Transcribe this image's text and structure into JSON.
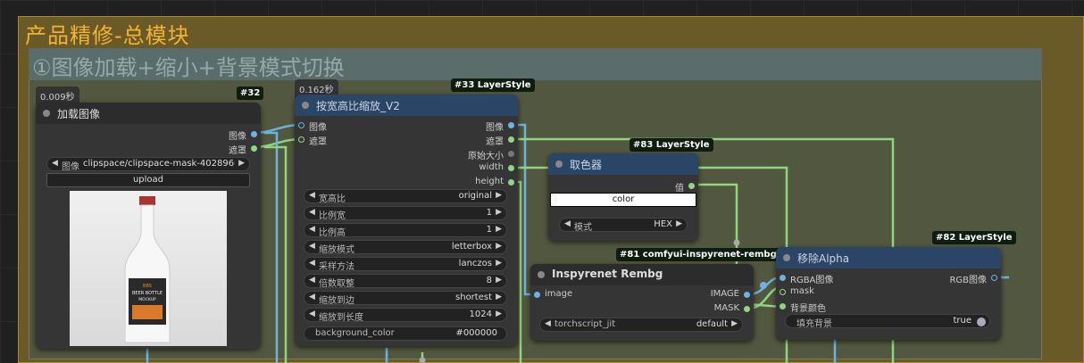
{
  "groups": {
    "outer_title": "产品精修-总模块",
    "inner_title": "①图像加载+缩小+背景模式切换"
  },
  "load_node": {
    "time": "0.009秒",
    "tag": "#32",
    "title": "加载图像",
    "outputs": [
      "图像",
      "遮罩"
    ],
    "image_widget": {
      "label": "图像",
      "value": "clipspace/clipspace-mask-4028960..."
    },
    "upload_label": "upload",
    "preview": {
      "cap_text": "BBS",
      "label_line1": "BEER BOTTLE",
      "label_line2": "MOCKUP"
    }
  },
  "scale_node": {
    "time": "0.162秒",
    "tag": "#33 LayerStyle",
    "title": "按宽高比缩放_V2",
    "inputs": [
      "图像",
      "遮罩"
    ],
    "outputs": [
      "图像",
      "遮罩",
      "原始大小",
      "width",
      "height"
    ],
    "widgets": [
      {
        "label": "宽高比",
        "value": "original"
      },
      {
        "label": "比例宽",
        "value": "1"
      },
      {
        "label": "比例高",
        "value": "1"
      },
      {
        "label": "缩放模式",
        "value": "letterbox"
      },
      {
        "label": "采样方法",
        "value": "lanczos"
      },
      {
        "label": "倍数取整",
        "value": "8"
      },
      {
        "label": "缩放到边",
        "value": "shortest"
      },
      {
        "label": "缩放到长度",
        "value": "1024"
      }
    ],
    "text_widget": {
      "label": "background_color",
      "value": "#000000"
    }
  },
  "color_node": {
    "tag": "#83 LayerStyle",
    "title": "取色器",
    "output": "值",
    "color_value": "color",
    "mode_widget": {
      "label": "模式",
      "value": "HEX"
    }
  },
  "rembg_node": {
    "tag": "#81 comfyui-inspyrenet-rembg",
    "title": "Inspyrenet Rembg",
    "input": "image",
    "outputs": [
      "IMAGE",
      "MASK"
    ],
    "widget": {
      "label": "torchscript_jit",
      "value": "default"
    }
  },
  "alpha_node": {
    "tag": "#82 LayerStyle",
    "title": "移除Alpha",
    "inputs": [
      "RGBA图像",
      "mask",
      "背景颜色"
    ],
    "output": "RGB图像",
    "toggle": {
      "label": "填充背景",
      "value": "true"
    }
  },
  "colors": {
    "image_wire": "#6fb1e0",
    "mask_wire": "#8fd67f",
    "group_outer": "#6a5a27",
    "group_inner": "#52573f"
  }
}
